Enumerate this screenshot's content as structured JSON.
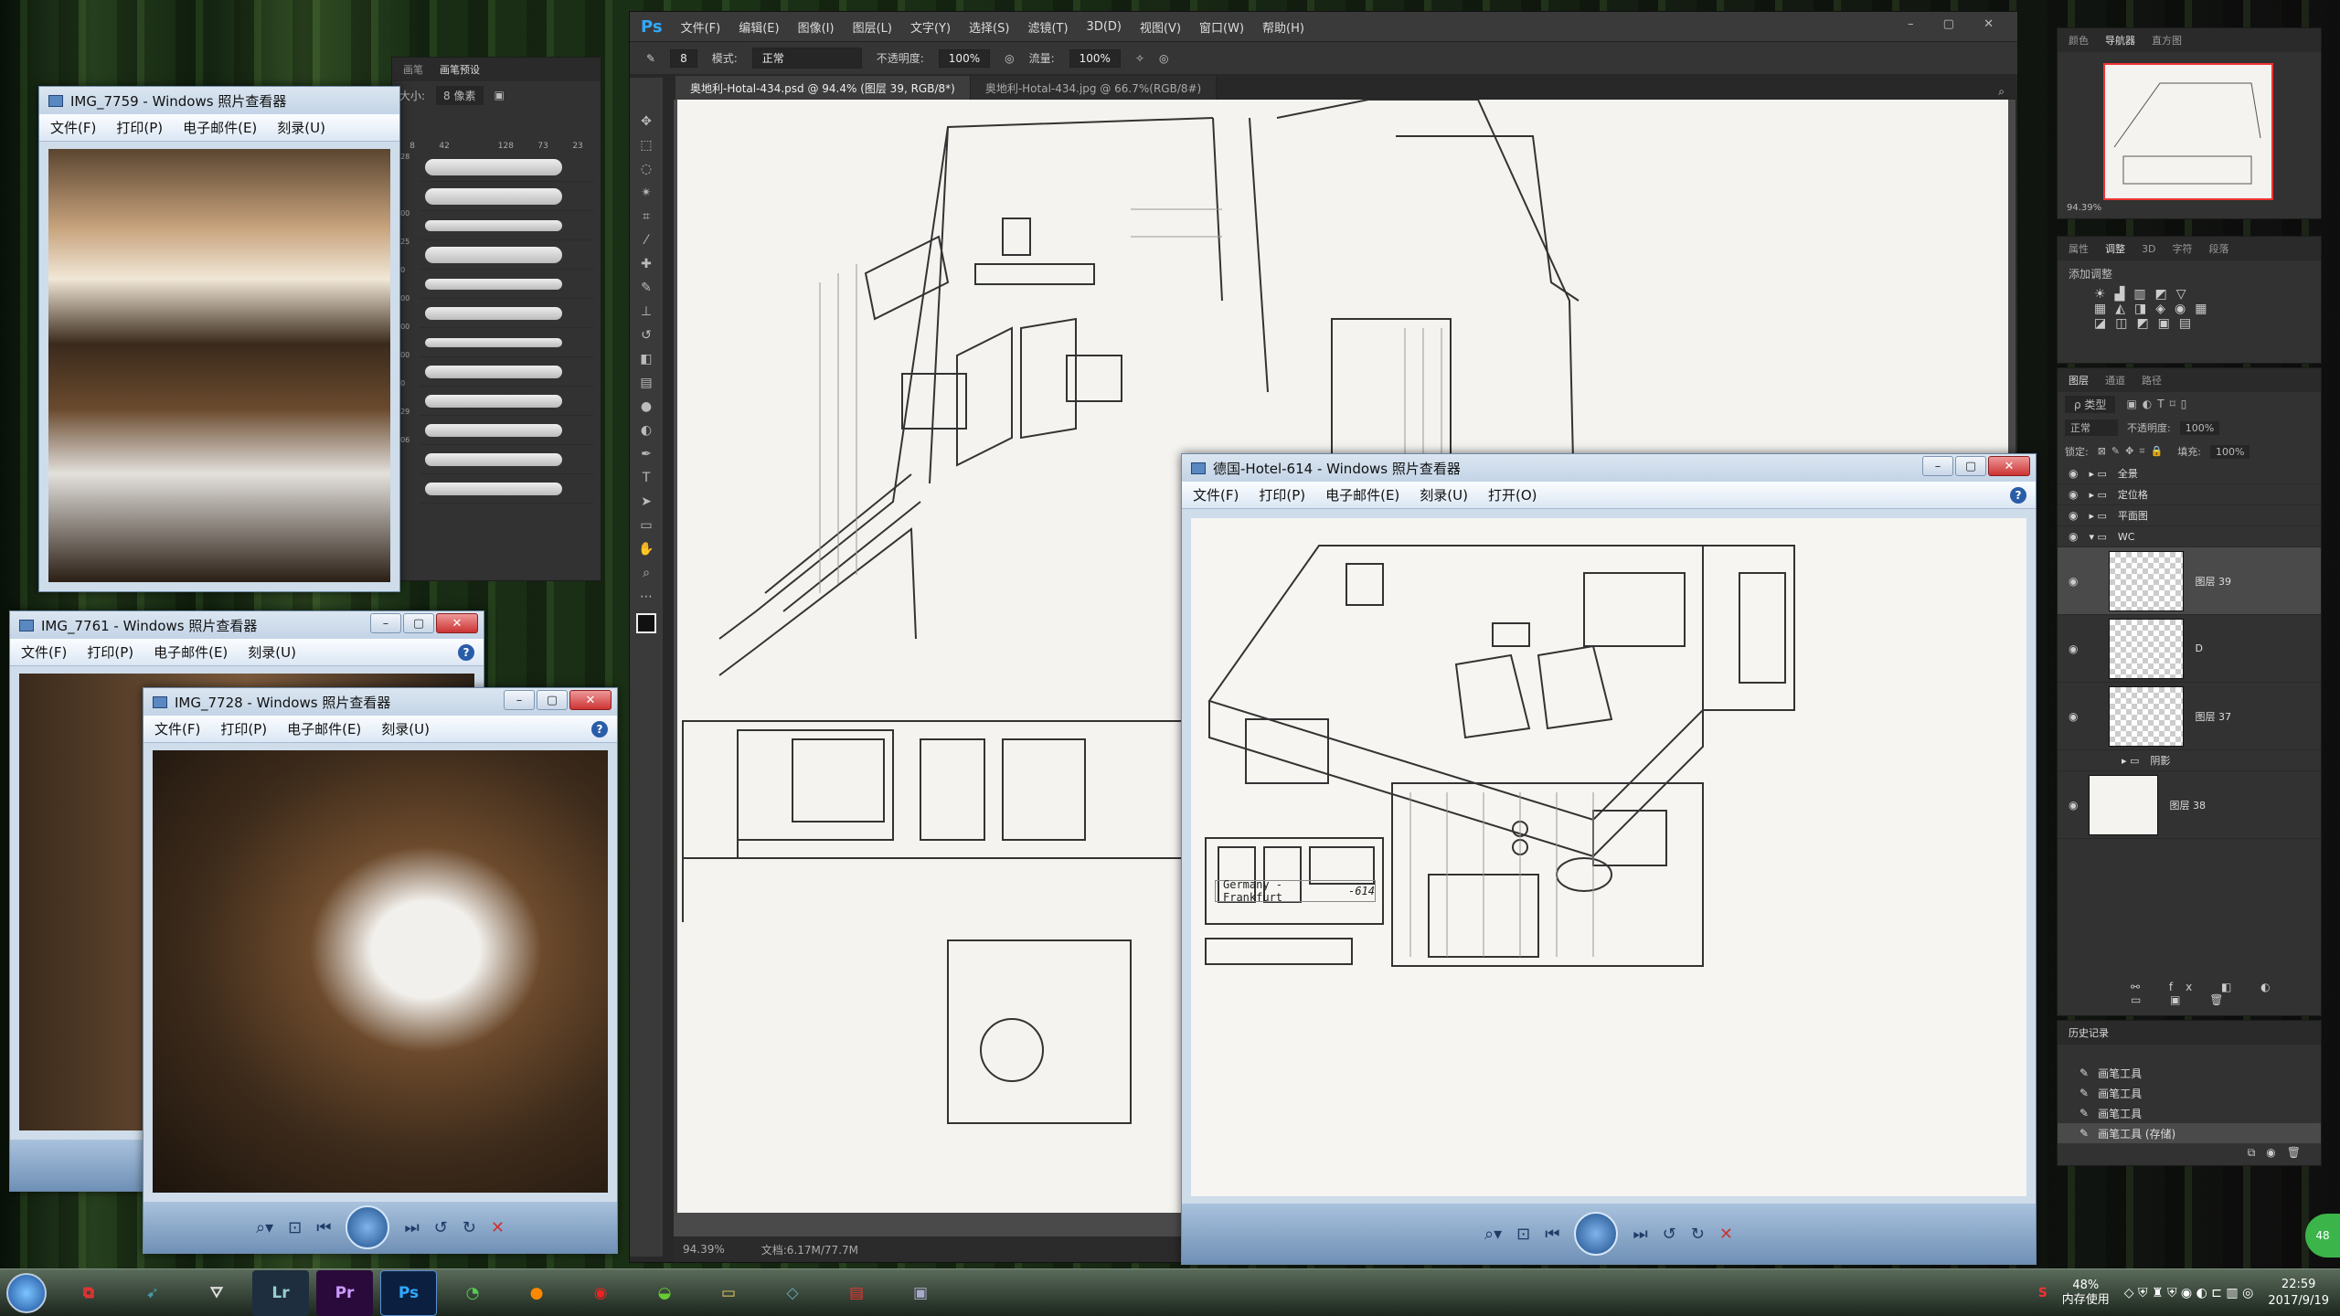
{
  "photoshop": {
    "logo": "Ps",
    "menu": [
      "文件(F)",
      "编辑(E)",
      "图像(I)",
      "图层(L)",
      "文字(Y)",
      "选择(S)",
      "滤镜(T)",
      "3D(D)",
      "视图(V)",
      "窗口(W)",
      "帮助(H)"
    ],
    "options": {
      "mode_label": "模式:",
      "mode_value": "正常",
      "opacity_label": "不透明度:",
      "opacity_value": "100%",
      "flow_label": "流量:",
      "flow_value": "100%",
      "size_value": "8"
    },
    "tabs": [
      "奥地利-Hotal-434.psd @ 94.4% (图层 39, RGB/8*)",
      "奥地利-Hotal-434.jpg @ 66.7%(RGB/8#)"
    ],
    "status": {
      "zoom": "94.39%",
      "doc": "文档:6.17M/77.7M"
    },
    "nav_zoom": "94.39%"
  },
  "brush_panel": {
    "tabs": [
      "画笔",
      "画笔预设"
    ],
    "size_label": "大小:",
    "size_value": "8 像素",
    "top_sizes": [
      "8",
      "42",
      "",
      "128",
      "73",
      "23"
    ],
    "side_sizes": [
      "128",
      "9",
      "100",
      "125",
      "80",
      "300",
      "100",
      "100",
      "60",
      "129",
      "106"
    ]
  },
  "panels": {
    "nav_tabs": [
      "颜色",
      "导航器",
      "直方图"
    ],
    "adj_tabs": [
      "属性",
      "调整",
      "3D",
      "字符",
      "段落"
    ],
    "add_adjust": "添加调整",
    "layers_tabs": [
      "图层",
      "通道",
      "路径"
    ],
    "kind": "ρ 类型",
    "blend": "正常",
    "opacity_label": "不透明度:",
    "opacity_value": "100%",
    "lock_label": "锁定:",
    "fill_label": "填充:",
    "fill_value": "100%",
    "groups": [
      "全景",
      "定位格",
      "平面图",
      "WC"
    ],
    "layers": [
      "图层 39",
      "D",
      "图层 37"
    ],
    "sub_group": "阴影",
    "bottom_layer": "图层 38",
    "history_title": "历史记录",
    "history": [
      "画笔工具",
      "画笔工具",
      "画笔工具",
      "画笔工具 (存储)"
    ]
  },
  "viewers": {
    "menu": [
      "文件(F)",
      "打印(P)",
      "电子邮件(E)",
      "刻录(U)"
    ],
    "menu_extra": "打开(O)",
    "w1_title": "IMG_7759 - Windows 照片查看器",
    "w2_title": "IMG_7761 - Windows 照片查看器",
    "w3_title": "IMG_7728 - Windows 照片查看器",
    "w4_title": "德国-Hotel-614 - Windows 照片查看器",
    "help": "?"
  },
  "sketch": {
    "label_city": "Germany -Frankfurt",
    "label_num": "-614"
  },
  "taskbar": {
    "apps": [
      "Lr",
      "Pr",
      "Ps"
    ],
    "mem_pct": "48%",
    "mem_label": "内存使用",
    "time": "22:59",
    "date": "2017/9/19",
    "ime": "S",
    "side_badge": "48"
  }
}
